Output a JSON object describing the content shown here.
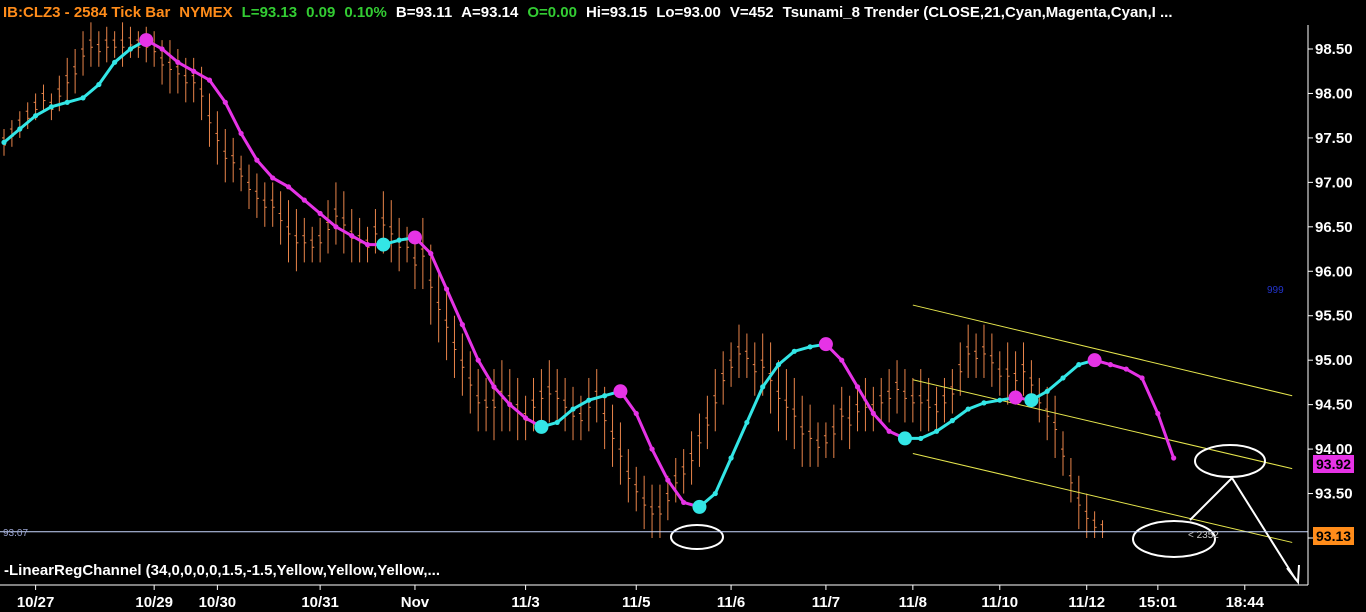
{
  "header": {
    "symbol": "IB:CLZ3 - 2584 Tick Bar",
    "exchange": "NYMEX",
    "last": "L=93.13",
    "change": "0.09",
    "change_pct": "0.10%",
    "bid": "B=93.11",
    "ask": "A=93.14",
    "open": "O=0.00",
    "high": "Hi=93.15",
    "low": "Lo=93.00",
    "volume": "V=452",
    "study": "Tsunami_8 Trender (CLOSE,21,Cyan,Magenta,Cyan,I ..."
  },
  "indicator_label": "-LinearRegChannel (34,0,0,0,0,1.5,-1.5,Yellow,Yellow,Yellow,...",
  "left_price_label": "93.07",
  "trender_tag": "93.92",
  "last_tag": "93.13",
  "bar_annotation": "< 2352",
  "small_marker": "999",
  "colors": {
    "bars": "#e8844a",
    "up_trend": "#33e6e6",
    "down_trend": "#e633e6",
    "channel": "#e6e64d",
    "trender_tag_bg": "#e633e6",
    "last_tag_bg": "#ff8c1a",
    "header_orange": "#ff8c1a",
    "header_green": "#33cc33",
    "header_white": "#ffffff"
  },
  "chart_data": {
    "type": "line",
    "title": "",
    "xlabel": "",
    "ylabel": "",
    "ylim": [
      92.75,
      98.8
    ],
    "y_ticks": [
      "98.50",
      "98.00",
      "97.50",
      "97.00",
      "96.50",
      "96.00",
      "95.50",
      "95.00",
      "94.50",
      "94.00",
      "93.50",
      "93.00"
    ],
    "y_tick_values": [
      98.5,
      98.0,
      97.5,
      97.0,
      96.5,
      96.0,
      95.5,
      95.0,
      94.5,
      94.0,
      93.5,
      93.0
    ],
    "x_labels": [
      "10/27",
      "10/29",
      "10/30",
      "10/31",
      "Nov",
      "11/3",
      "11/5",
      "11/6",
      "11/7",
      "11/8",
      "11/10",
      "11/12",
      "15:01",
      "18:44"
    ],
    "x_label_bar_index": [
      4,
      19,
      27,
      40,
      52,
      66,
      80,
      92,
      104,
      115,
      126,
      137,
      146,
      157
    ],
    "total_bar_slots": 165,
    "trender_line": {
      "name": "Tsunami_8 Trender",
      "points": [
        [
          0,
          97.45
        ],
        [
          2,
          97.6
        ],
        [
          4,
          97.75
        ],
        [
          6,
          97.85
        ],
        [
          8,
          97.9
        ],
        [
          10,
          97.95
        ],
        [
          12,
          98.1
        ],
        [
          14,
          98.35
        ],
        [
          16,
          98.5
        ],
        [
          18,
          98.6
        ],
        [
          20,
          98.5
        ],
        [
          22,
          98.35
        ],
        [
          24,
          98.25
        ],
        [
          26,
          98.15
        ],
        [
          28,
          97.9
        ],
        [
          30,
          97.55
        ],
        [
          32,
          97.25
        ],
        [
          34,
          97.05
        ],
        [
          36,
          96.95
        ],
        [
          38,
          96.8
        ],
        [
          40,
          96.65
        ],
        [
          42,
          96.5
        ],
        [
          44,
          96.4
        ],
        [
          46,
          96.3
        ],
        [
          48,
          96.3
        ],
        [
          50,
          96.35
        ],
        [
          52,
          96.38
        ],
        [
          54,
          96.2
        ],
        [
          56,
          95.8
        ],
        [
          58,
          95.4
        ],
        [
          60,
          95.0
        ],
        [
          62,
          94.7
        ],
        [
          64,
          94.5
        ],
        [
          66,
          94.35
        ],
        [
          68,
          94.25
        ],
        [
          70,
          94.3
        ],
        [
          72,
          94.45
        ],
        [
          74,
          94.55
        ],
        [
          76,
          94.6
        ],
        [
          78,
          94.65
        ],
        [
          80,
          94.4
        ],
        [
          82,
          94.0
        ],
        [
          84,
          93.65
        ],
        [
          86,
          93.4
        ],
        [
          88,
          93.35
        ],
        [
          90,
          93.5
        ],
        [
          92,
          93.9
        ],
        [
          94,
          94.3
        ],
        [
          96,
          94.7
        ],
        [
          98,
          94.95
        ],
        [
          100,
          95.1
        ],
        [
          102,
          95.15
        ],
        [
          104,
          95.18
        ],
        [
          106,
          95.0
        ],
        [
          108,
          94.7
        ],
        [
          110,
          94.4
        ],
        [
          112,
          94.2
        ],
        [
          114,
          94.12
        ],
        [
          116,
          94.12
        ],
        [
          118,
          94.2
        ],
        [
          120,
          94.32
        ],
        [
          122,
          94.45
        ],
        [
          124,
          94.52
        ],
        [
          126,
          94.55
        ],
        [
          128,
          94.58
        ],
        [
          130,
          94.55
        ],
        [
          132,
          94.65
        ],
        [
          134,
          94.8
        ],
        [
          136,
          94.95
        ],
        [
          138,
          95.0
        ],
        [
          140,
          94.95
        ],
        [
          142,
          94.9
        ],
        [
          144,
          94.8
        ],
        [
          146,
          94.4
        ],
        [
          148,
          93.9
        ]
      ],
      "up_ranges": [
        [
          0,
          18
        ],
        [
          48,
          52
        ],
        [
          68,
          78
        ],
        [
          88,
          104
        ],
        [
          114,
          128
        ],
        [
          130,
          138
        ]
      ],
      "down_ranges": [
        [
          18,
          48
        ],
        [
          52,
          68
        ],
        [
          78,
          88
        ],
        [
          104,
          114
        ],
        [
          128,
          130
        ],
        [
          138,
          148
        ]
      ],
      "up_dots": [
        48,
        68,
        88,
        114,
        130
      ],
      "down_dots": [
        18,
        52,
        78,
        104,
        128,
        138
      ]
    },
    "bars": {
      "name": "CLZ3 2584 Tick Bar",
      "bar_index_start": 0,
      "ohlc_note": "estimated from chart",
      "high_low": [
        [
          97.6,
          97.3
        ],
        [
          97.7,
          97.4
        ],
        [
          97.8,
          97.5
        ],
        [
          97.9,
          97.6
        ],
        [
          98.0,
          97.7
        ],
        [
          98.1,
          97.8
        ],
        [
          98.0,
          97.7
        ],
        [
          98.2,
          97.8
        ],
        [
          98.4,
          97.9
        ],
        [
          98.5,
          98.0
        ],
        [
          98.7,
          98.2
        ],
        [
          98.8,
          98.3
        ],
        [
          98.7,
          98.3
        ],
        [
          98.75,
          98.35
        ],
        [
          98.7,
          98.4
        ],
        [
          98.8,
          98.3
        ],
        [
          98.75,
          98.4
        ],
        [
          98.7,
          98.4
        ],
        [
          98.75,
          98.35
        ],
        [
          98.7,
          98.3
        ],
        [
          98.6,
          98.1
        ],
        [
          98.6,
          98.0
        ],
        [
          98.5,
          98.0
        ],
        [
          98.4,
          97.9
        ],
        [
          98.4,
          97.9
        ],
        [
          98.3,
          97.7
        ],
        [
          98.0,
          97.4
        ],
        [
          97.8,
          97.2
        ],
        [
          97.6,
          97.0
        ],
        [
          97.5,
          97.0
        ],
        [
          97.3,
          96.9
        ],
        [
          97.2,
          96.7
        ],
        [
          97.1,
          96.6
        ],
        [
          97.0,
          96.5
        ],
        [
          97.0,
          96.5
        ],
        [
          96.9,
          96.3
        ],
        [
          96.8,
          96.1
        ],
        [
          96.7,
          96.0
        ],
        [
          96.6,
          96.1
        ],
        [
          96.5,
          96.1
        ],
        [
          96.6,
          96.1
        ],
        [
          96.8,
          96.2
        ],
        [
          97.0,
          96.3
        ],
        [
          96.9,
          96.2
        ],
        [
          96.7,
          96.1
        ],
        [
          96.6,
          96.1
        ],
        [
          96.5,
          96.1
        ],
        [
          96.7,
          96.2
        ],
        [
          96.9,
          96.2
        ],
        [
          96.8,
          96.1
        ],
        [
          96.6,
          96.0
        ],
        [
          96.5,
          96.1
        ],
        [
          96.4,
          95.8
        ],
        [
          96.6,
          95.8
        ],
        [
          96.3,
          95.4
        ],
        [
          96.0,
          95.2
        ],
        [
          95.8,
          95.0
        ],
        [
          95.5,
          94.8
        ],
        [
          95.3,
          94.6
        ],
        [
          95.1,
          94.4
        ],
        [
          94.9,
          94.2
        ],
        [
          94.8,
          94.2
        ],
        [
          94.9,
          94.1
        ],
        [
          95.0,
          94.2
        ],
        [
          94.9,
          94.2
        ],
        [
          94.8,
          94.1
        ],
        [
          94.6,
          94.1
        ],
        [
          94.8,
          94.2
        ],
        [
          94.9,
          94.3
        ],
        [
          95.0,
          94.3
        ],
        [
          94.9,
          94.3
        ],
        [
          94.8,
          94.2
        ],
        [
          94.7,
          94.1
        ],
        [
          94.6,
          94.1
        ],
        [
          94.8,
          94.2
        ],
        [
          94.9,
          94.3
        ],
        [
          94.7,
          94.0
        ],
        [
          94.5,
          93.8
        ],
        [
          94.3,
          93.6
        ],
        [
          94.0,
          93.4
        ],
        [
          93.8,
          93.3
        ],
        [
          93.7,
          93.1
        ],
        [
          93.6,
          93.0
        ],
        [
          93.6,
          93.0
        ],
        [
          93.7,
          93.2
        ],
        [
          93.9,
          93.4
        ],
        [
          94.0,
          93.5
        ],
        [
          94.2,
          93.6
        ],
        [
          94.4,
          93.8
        ],
        [
          94.6,
          94.0
        ],
        [
          94.9,
          94.2
        ],
        [
          95.1,
          94.5
        ],
        [
          95.2,
          94.7
        ],
        [
          95.4,
          94.8
        ],
        [
          95.3,
          94.8
        ],
        [
          95.2,
          94.6
        ],
        [
          95.3,
          94.6
        ],
        [
          95.2,
          94.4
        ],
        [
          95.0,
          94.2
        ],
        [
          94.9,
          94.1
        ],
        [
          94.8,
          94.0
        ],
        [
          94.6,
          93.8
        ],
        [
          94.5,
          93.8
        ],
        [
          94.3,
          93.8
        ],
        [
          94.3,
          93.9
        ],
        [
          94.5,
          93.9
        ],
        [
          94.7,
          94.1
        ],
        [
          94.6,
          94.0
        ],
        [
          94.7,
          94.2
        ],
        [
          94.8,
          94.2
        ],
        [
          94.7,
          94.2
        ],
        [
          94.8,
          94.3
        ],
        [
          94.9,
          94.3
        ],
        [
          95.0,
          94.4
        ],
        [
          94.9,
          94.3
        ],
        [
          94.8,
          94.3
        ],
        [
          94.9,
          94.2
        ],
        [
          94.8,
          94.2
        ],
        [
          94.7,
          94.2
        ],
        [
          94.8,
          94.3
        ],
        [
          94.9,
          94.4
        ],
        [
          95.2,
          94.6
        ],
        [
          95.4,
          94.8
        ],
        [
          95.3,
          94.8
        ],
        [
          95.4,
          94.8
        ],
        [
          95.3,
          94.7
        ],
        [
          95.1,
          94.6
        ],
        [
          95.2,
          94.5
        ],
        [
          95.1,
          94.5
        ],
        [
          95.2,
          94.6
        ],
        [
          95.0,
          94.5
        ],
        [
          94.8,
          94.3
        ],
        [
          94.7,
          94.1
        ],
        [
          94.6,
          93.9
        ],
        [
          94.2,
          93.7
        ],
        [
          93.9,
          93.4
        ],
        [
          93.7,
          93.1
        ],
        [
          93.5,
          93.0
        ],
        [
          93.3,
          93.0
        ],
        [
          93.2,
          93.0
        ]
      ]
    },
    "regression_channel": {
      "name": "LinearRegChannel",
      "lines": [
        {
          "start": [
            115,
            95.62
          ],
          "end": [
            163,
            94.6
          ]
        },
        {
          "start": [
            115,
            94.78
          ],
          "end": [
            163,
            93.78
          ]
        },
        {
          "start": [
            115,
            93.95
          ],
          "end": [
            163,
            92.95
          ]
        }
      ]
    },
    "reference_line": {
      "y": 93.07
    }
  }
}
